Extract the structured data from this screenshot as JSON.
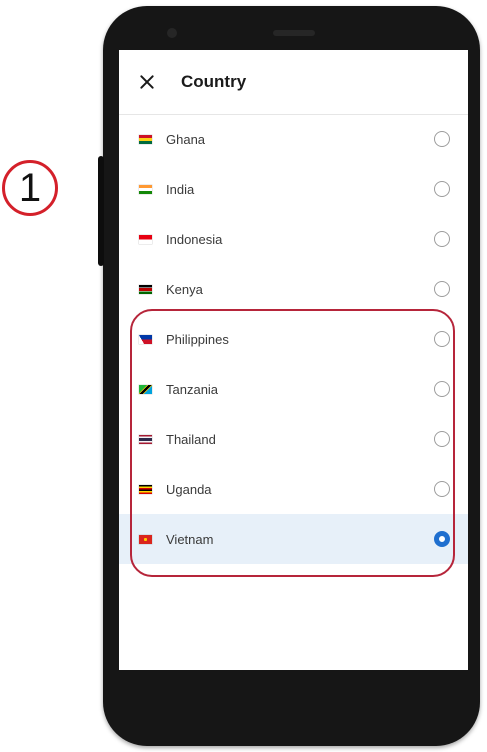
{
  "step": {
    "number": "1"
  },
  "header": {
    "title": "Country"
  },
  "countries": [
    {
      "name": "Ghana",
      "selected": false
    },
    {
      "name": "India",
      "selected": false
    },
    {
      "name": "Indonesia",
      "selected": false
    },
    {
      "name": "Kenya",
      "selected": false
    },
    {
      "name": "Philippines",
      "selected": false
    },
    {
      "name": "Tanzania",
      "selected": false
    },
    {
      "name": "Thailand",
      "selected": false
    },
    {
      "name": "Uganda",
      "selected": false
    },
    {
      "name": "Vietnam",
      "selected": true
    }
  ],
  "colors": {
    "accent": "#1f6fcf",
    "selected_row": "#e7f0f9",
    "highlight": "#b6253a"
  }
}
